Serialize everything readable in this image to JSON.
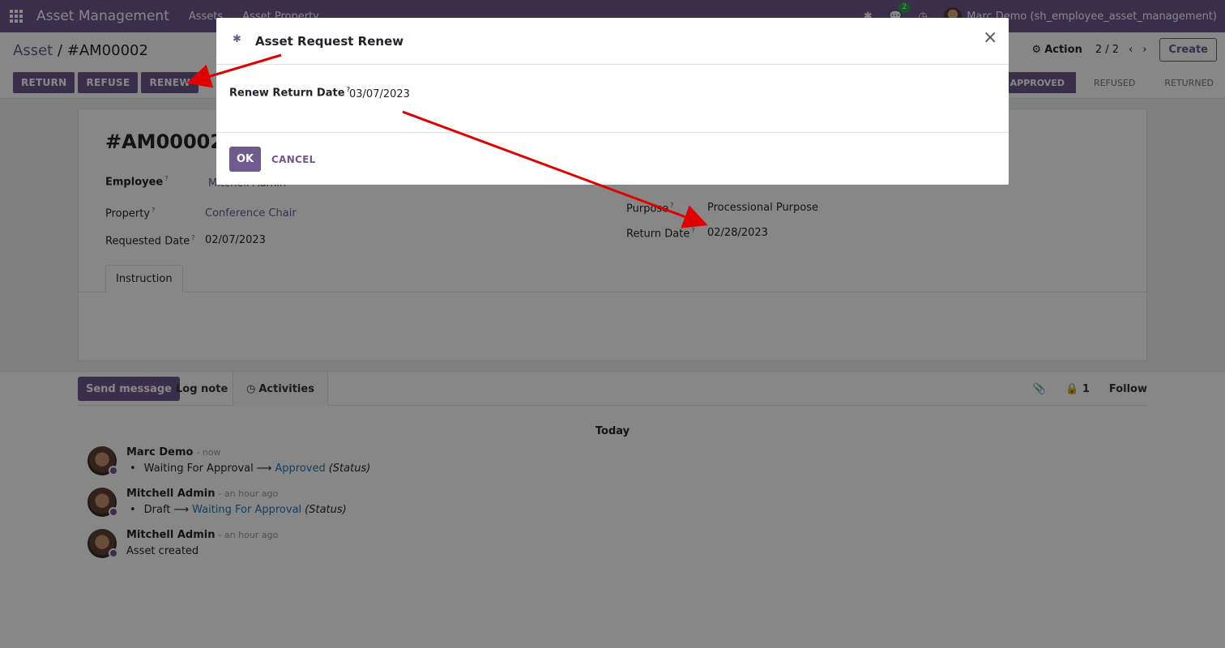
{
  "navbar": {
    "brand": "Asset Management",
    "menus": [
      "Assets",
      "Asset Property"
    ],
    "chat_count": "2",
    "user": "Marc Demo (sh_employee_asset_management)"
  },
  "control": {
    "breadcrumb_parent": "Asset",
    "breadcrumb_sep": "/",
    "breadcrumb_current": "#AM00002",
    "action_label": "Action",
    "pager": "2 / 2",
    "create_label": "Create",
    "buttons": [
      "RETURN",
      "REFUSE",
      "RENEW"
    ],
    "stages": [
      "APPROVED",
      "REFUSED",
      "RETURNED"
    ]
  },
  "form": {
    "title": "#AM00002",
    "employee_label": "Employee",
    "employee_value": "Mitchell Admin",
    "property_label": "Property",
    "property_value": "Conference Chair",
    "requested_date_label": "Requested Date",
    "requested_date_value": "02/07/2023",
    "purpose_label": "Purpose",
    "purpose_value": "Processional Purpose",
    "return_date_label": "Return Date",
    "return_date_value": "02/28/2023",
    "tab_instruction": "Instruction"
  },
  "chatter": {
    "send_message": "Send message",
    "log_note": "Log note",
    "activities": "Activities",
    "followers_count": "1",
    "follow": "Follow",
    "today": "Today",
    "messages": [
      {
        "author": "Marc Demo",
        "date": "- now",
        "old": "Waiting For Approval",
        "new": "Approved",
        "field": "(Status)"
      },
      {
        "author": "Mitchell Admin",
        "date": "- an hour ago",
        "old": "Draft",
        "new": "Waiting For Approval",
        "field": "(Status)"
      },
      {
        "author": "Mitchell Admin",
        "date": "- an hour ago",
        "text": "Asset created"
      }
    ]
  },
  "dialog": {
    "title": "Asset Request Renew",
    "renew_label": "Renew Return Date",
    "renew_value": "03/07/2023",
    "ok": "OK",
    "cancel": "CANCEL"
  },
  "colors": {
    "brand": "#6f5a8f",
    "annotation_arrow": "#e00000"
  },
  "icons": [
    "apps-grid-icon",
    "bug-icon",
    "chat-icon",
    "clock-icon",
    "gear-icon",
    "chevron-left-icon",
    "chevron-right-icon",
    "paperclip-icon",
    "lock-icon",
    "close-icon"
  ]
}
